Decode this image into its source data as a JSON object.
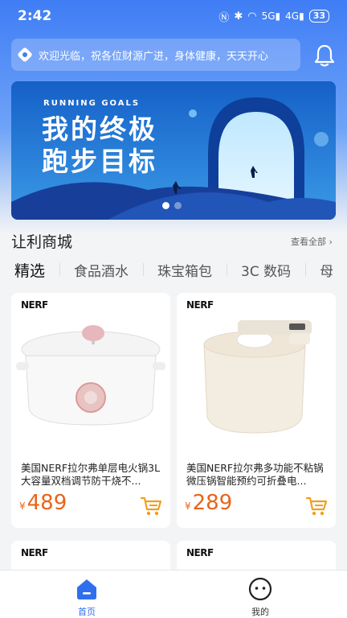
{
  "status": {
    "time": "2:42",
    "battery": "33",
    "net1": "5G",
    "net2": "4G"
  },
  "notice": {
    "text": "欢迎光临，祝各位财源广进，身体健康，天天开心"
  },
  "banner": {
    "subtitle": "RUNNING GOALS",
    "title_line1": "我的终极",
    "title_line2": "跑步目标",
    "page_count": 2,
    "active_page": 1
  },
  "section": {
    "title": "让利商城",
    "see_all": "查看全部 ›"
  },
  "categories": [
    "精选",
    "食品酒水",
    "珠宝箱包",
    "3C 数码",
    "母"
  ],
  "products": [
    {
      "brand": "NERF",
      "name": "美国NERF拉尔弗单层电火锅3L大容量双档调节防干烧不...",
      "currency": "¥",
      "price": "489"
    },
    {
      "brand": "NERF",
      "name": "美国NERF拉尔弗多功能不粘锅微压锅智能预约可折叠电...",
      "currency": "¥",
      "price": "289"
    },
    {
      "brand": "NERF"
    },
    {
      "brand": "NERF"
    }
  ],
  "nav": [
    {
      "label": "首页",
      "icon": "home-icon",
      "active": true
    },
    {
      "label": "我的",
      "icon": "profile-icon",
      "active": false
    }
  ],
  "colors": {
    "primary": "#2f6fee",
    "price": "#e8651a",
    "cart": "#f0a020"
  }
}
